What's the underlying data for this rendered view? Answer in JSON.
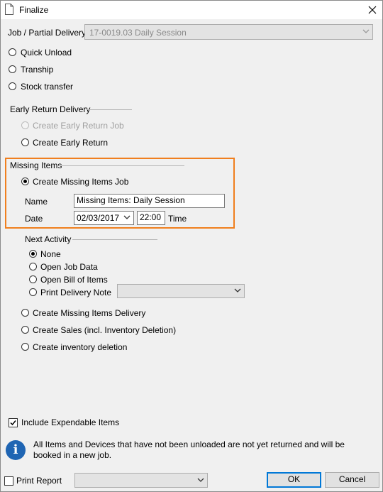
{
  "window": {
    "title": "Finalize"
  },
  "job": {
    "label": "Job / Partial Delivery",
    "value": "17-0019.03 Daily Session"
  },
  "top_options": [
    {
      "label": "Quick Unload",
      "checked": false
    },
    {
      "label": "Tranship",
      "checked": false
    },
    {
      "label": "Stock transfer",
      "checked": false
    }
  ],
  "early_return": {
    "title": "Early Return Delivery",
    "options": [
      {
        "label": "Create Early Return Job",
        "checked": false,
        "disabled": true
      },
      {
        "label": "Create Early Return",
        "checked": false,
        "disabled": false
      }
    ]
  },
  "missing_items": {
    "title": "Missing Items",
    "option_label": "Create Missing Items Job",
    "name_label": "Name",
    "name_value": "Missing Items: Daily Session",
    "date_label": "Date",
    "date_value": "02/03/2017",
    "time_value": "22:00",
    "time_label": "Time"
  },
  "next_activity": {
    "title": "Next Activity",
    "options": [
      {
        "label": "None",
        "checked": true
      },
      {
        "label": "Open Job Data",
        "checked": false
      },
      {
        "label": "Open Bill of Items",
        "checked": false
      },
      {
        "label": "Print Delivery Note",
        "checked": false
      }
    ],
    "print_select_value": ""
  },
  "other_options": [
    {
      "label": "Create Missing Items Delivery",
      "checked": false
    },
    {
      "label": "Create Sales (incl. Inventory Deletion)",
      "checked": false
    },
    {
      "label": "Create inventory deletion",
      "checked": false
    }
  ],
  "include_expendable": {
    "label": "Include Expendable Items",
    "checked": true
  },
  "info": {
    "icon": "info-icon",
    "glyph": "i",
    "text": "All Items and Devices that have not been unloaded are not yet returned and will be booked in a new job."
  },
  "footer": {
    "print_report_label": "Print Report",
    "print_report_checked": false,
    "report_select_value": "",
    "ok_label": "OK",
    "cancel_label": "Cancel"
  },
  "colors": {
    "highlight": "#f07f1e",
    "info": "#1f65b3",
    "default_button": "#0078d7"
  }
}
